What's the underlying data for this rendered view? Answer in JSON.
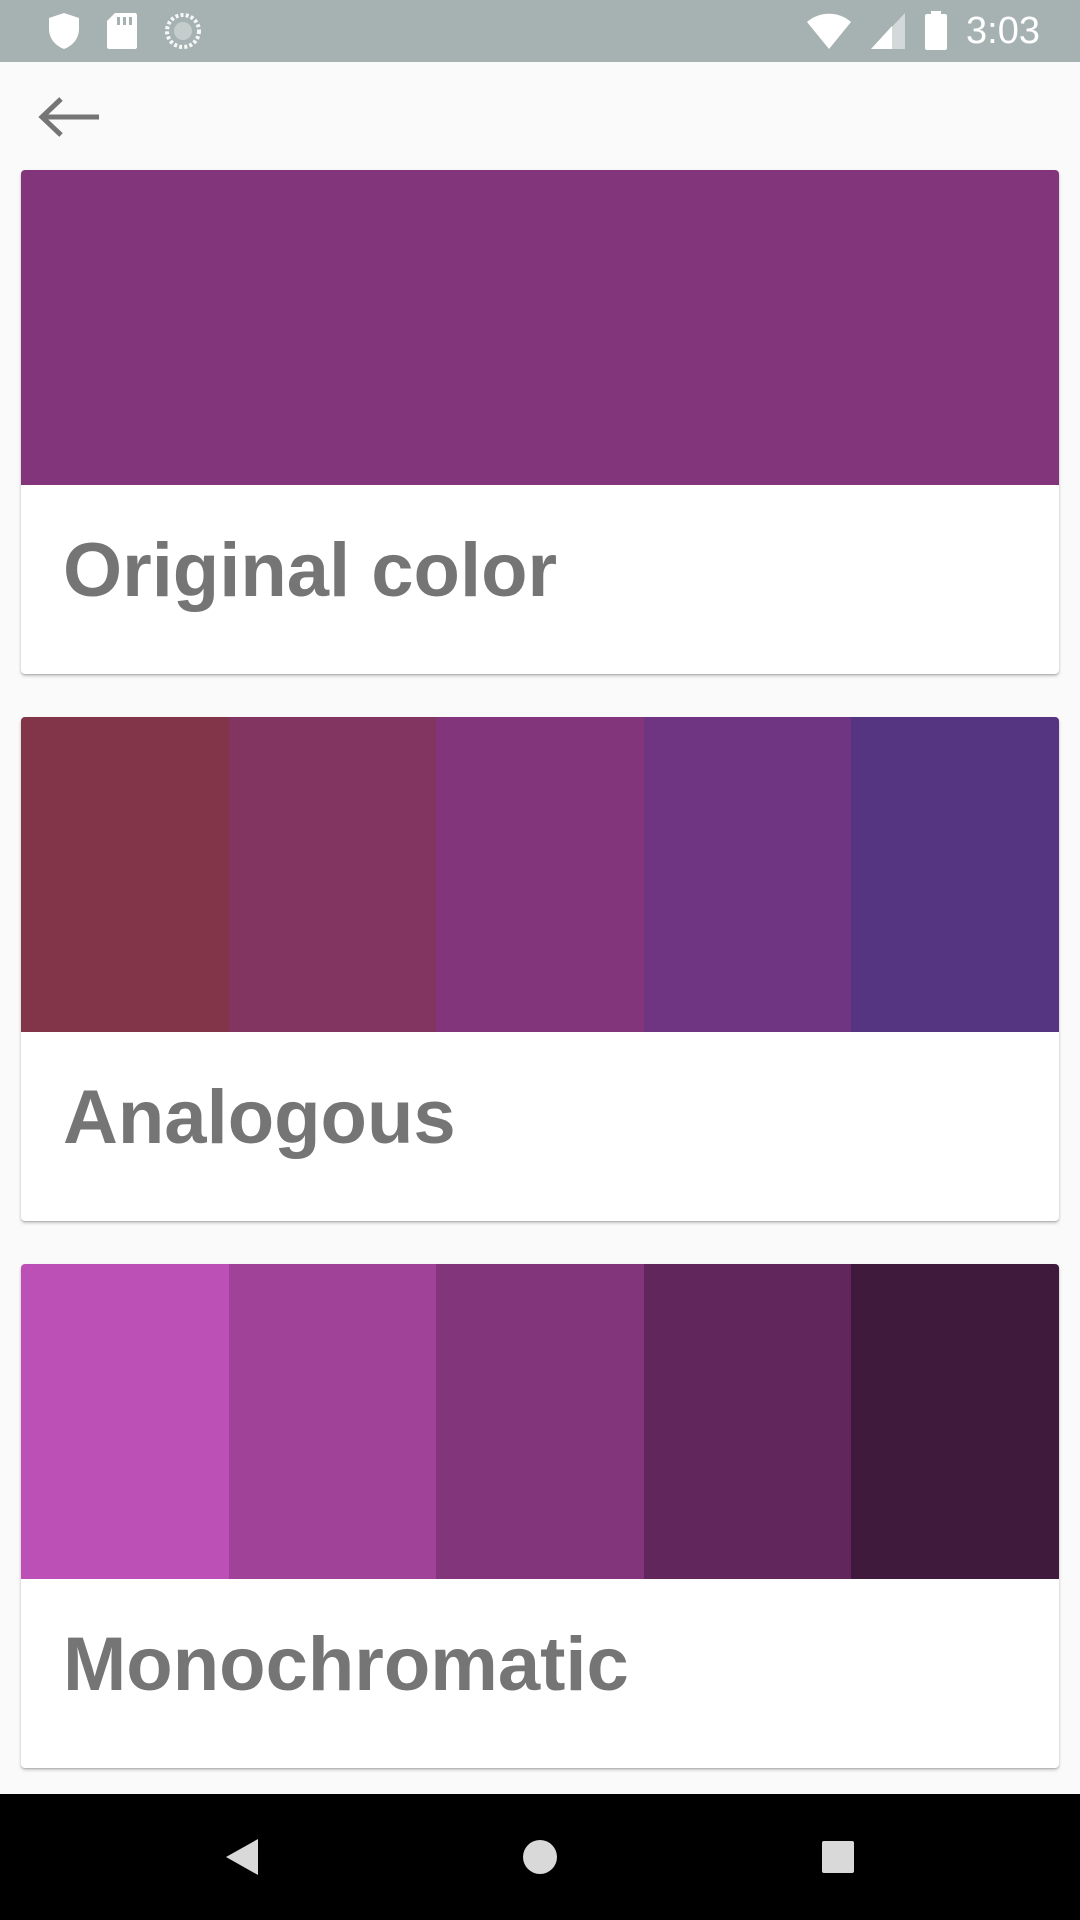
{
  "status_bar": {
    "time": "3:03",
    "left_icons": [
      "shield-icon",
      "sd-card-icon",
      "sync-icon"
    ],
    "right_icons": [
      "wifi-icon",
      "cellular-signal-icon",
      "battery-icon"
    ]
  },
  "app_bar": {
    "back_icon": "arrow-left-icon"
  },
  "cards": [
    {
      "title": "Original color",
      "swatches": [
        "#82357b"
      ]
    },
    {
      "title": "Analogous",
      "swatches": [
        "#823449",
        "#823561",
        "#82357b",
        "#6f3582",
        "#553582"
      ]
    },
    {
      "title": "Monochromatic",
      "swatches": [
        "#bd50b6",
        "#a04298",
        "#82357b",
        "#61275c",
        "#3f1a3c"
      ]
    }
  ],
  "nav_bar": {
    "icons": [
      "nav-back-icon",
      "nav-home-icon",
      "nav-recents-icon"
    ]
  }
}
